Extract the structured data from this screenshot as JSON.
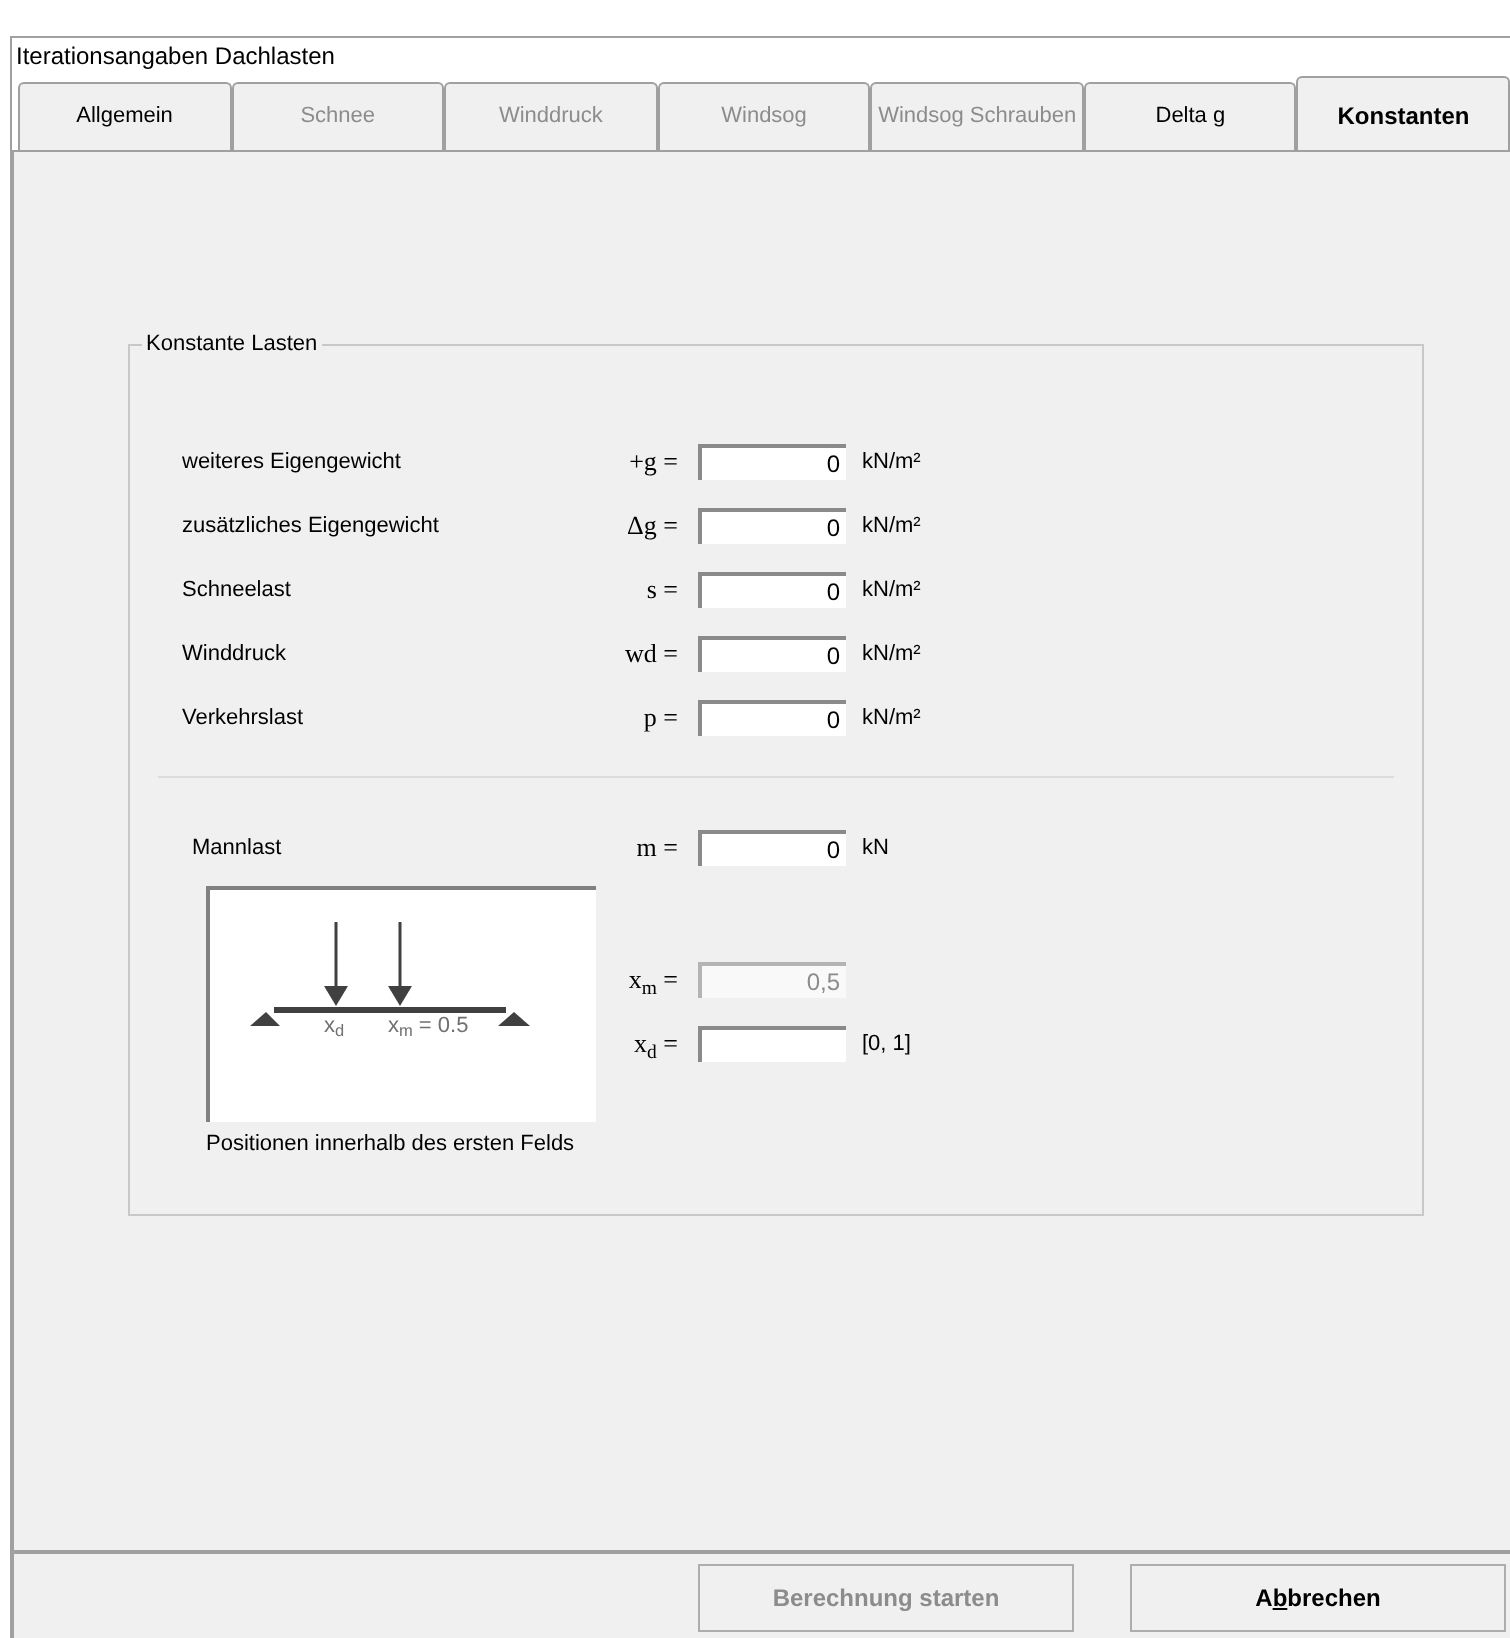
{
  "window": {
    "title": "Iterationsangaben Dachlasten"
  },
  "tabs": [
    {
      "label": "Allgemein",
      "selected": false,
      "disabled": false
    },
    {
      "label": "Schnee",
      "selected": false,
      "disabled": true
    },
    {
      "label": "Winddruck",
      "selected": false,
      "disabled": true
    },
    {
      "label": "Windsog",
      "selected": false,
      "disabled": true
    },
    {
      "label": "Windsog Schrauben",
      "selected": false,
      "disabled": true
    },
    {
      "label": "Delta g",
      "selected": false,
      "disabled": false
    },
    {
      "label": "Konstanten",
      "selected": true,
      "disabled": false
    }
  ],
  "group": {
    "title": "Konstante Lasten",
    "loads": [
      {
        "label": "weiteres Eigengewicht",
        "symbol": "+g =",
        "value": "0",
        "unit": "kN/m²"
      },
      {
        "label": "zusätzliches Eigengewicht",
        "symbol": "Δg =",
        "value": "0",
        "unit": "kN/m²"
      },
      {
        "label": "Schneelast",
        "symbol": "s =",
        "value": "0",
        "unit": "kN/m²"
      },
      {
        "label": "Winddruck",
        "symbol": "wd =",
        "value": "0",
        "unit": "kN/m²"
      },
      {
        "label": "Verkehrslast",
        "symbol": "p =",
        "value": "0",
        "unit": "kN/m²"
      }
    ],
    "man_load": {
      "label": "Mannlast",
      "symbol": "m =",
      "value": "0",
      "unit": "kN"
    },
    "diagram": {
      "label_d": "x$_{d}$",
      "label_m": "x$_{m}$ = 0.5",
      "caption": "Positionen innerhalb des ersten Felds"
    },
    "positions": [
      {
        "symbol": "x$_{m}$ =",
        "value": "0,5",
        "disabled": true
      },
      {
        "symbol": "x$_{d}$ =",
        "disabled": false,
        "hint": "[0, 1]"
      }
    ]
  },
  "buttons": [
    {
      "label": "Berechnung starten",
      "disabled": true
    },
    {
      "label_start": "A",
      "underlined": "b",
      "label_end": "brechen",
      "disabled": false
    }
  ]
}
